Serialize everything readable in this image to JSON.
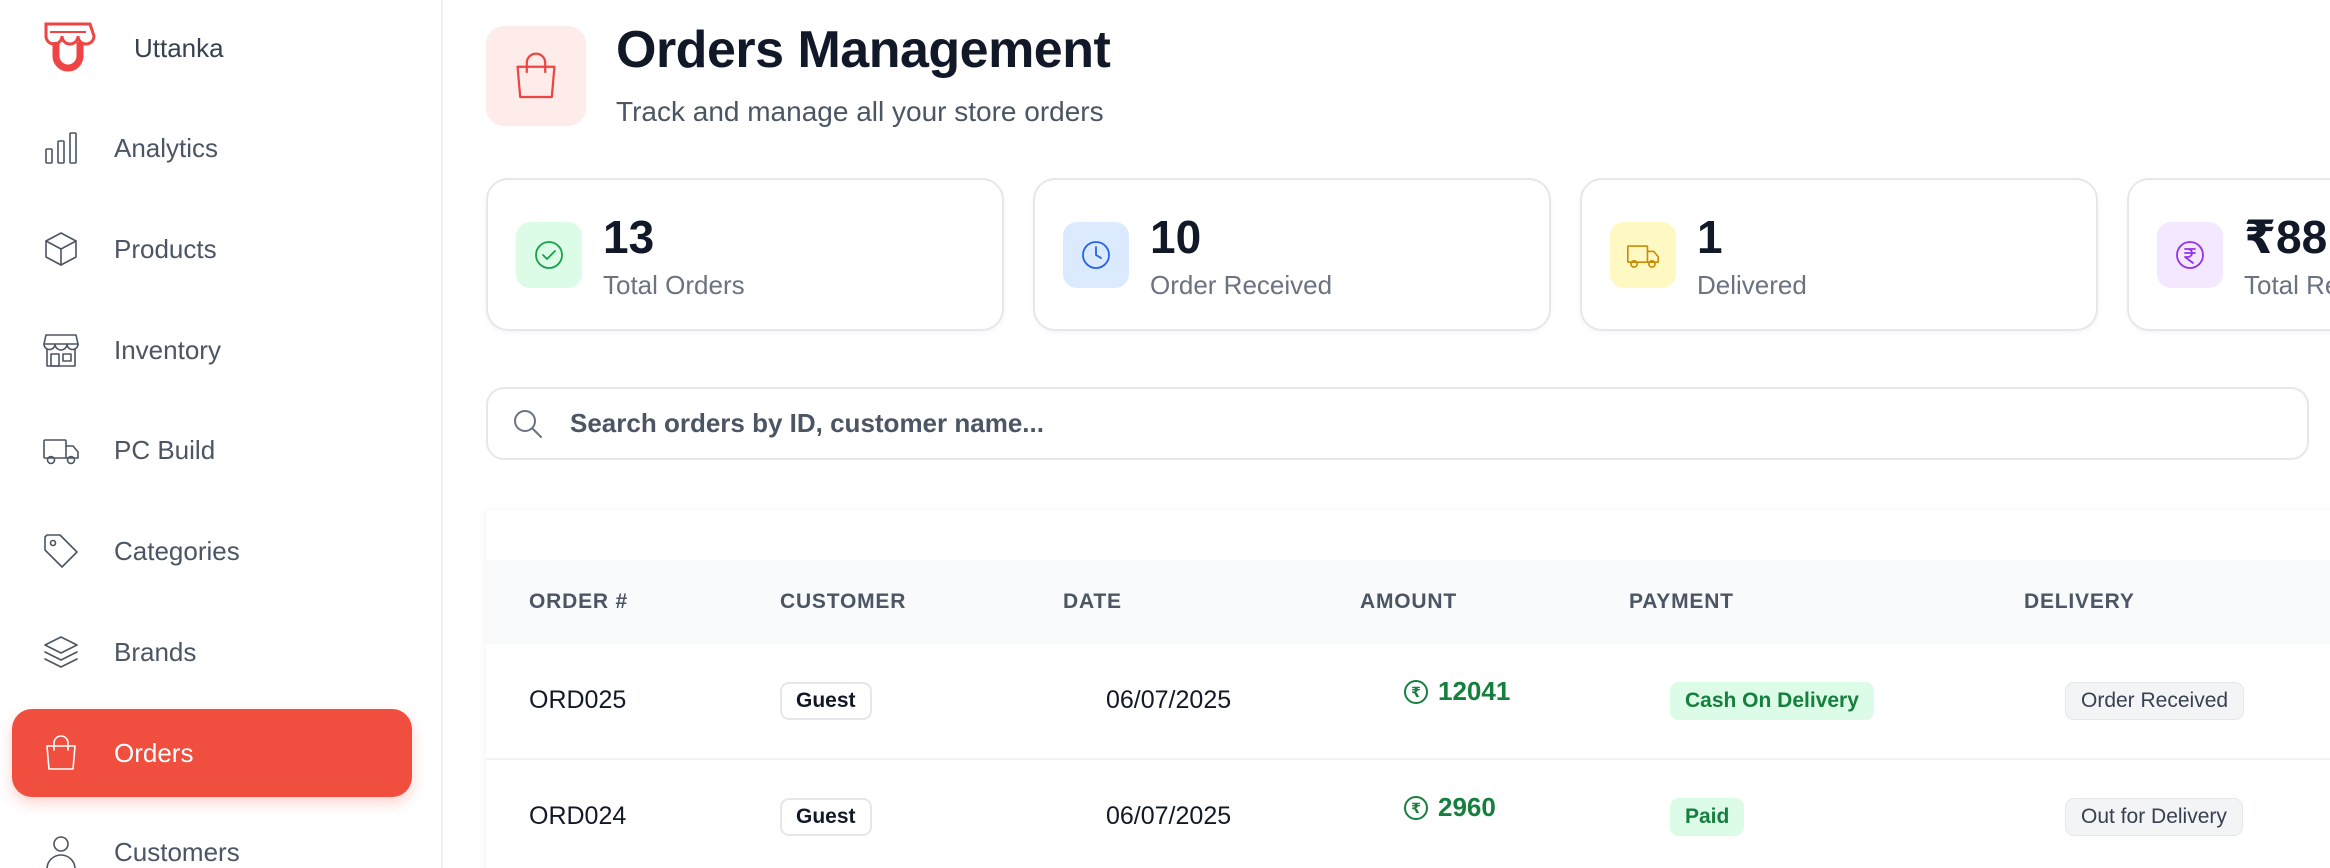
{
  "colors": {
    "accent": "#f04e3e",
    "success": "#15803d",
    "text_primary": "#111827",
    "text_secondary": "#4b5563"
  },
  "sidebar": {
    "brand": {
      "name": "Uttanka",
      "logo_icon": "store-logo-icon"
    },
    "items": [
      {
        "label": "Analytics",
        "icon": "bar-chart-icon",
        "active": false
      },
      {
        "label": "Products",
        "icon": "box-icon",
        "active": false
      },
      {
        "label": "Inventory",
        "icon": "store-icon",
        "active": false
      },
      {
        "label": "PC Build",
        "icon": "truck-icon",
        "active": false
      },
      {
        "label": "Categories",
        "icon": "tag-icon",
        "active": false
      },
      {
        "label": "Brands",
        "icon": "layers-icon",
        "active": false
      },
      {
        "label": "Orders",
        "icon": "shopping-bag-icon",
        "active": true
      },
      {
        "label": "Customers",
        "icon": "user-icon",
        "active": false
      }
    ]
  },
  "header": {
    "icon": "shopping-bag-icon",
    "title": "Orders Management",
    "subtitle": "Track and manage all your store orders"
  },
  "stats": [
    {
      "value": "13",
      "label": "Total Orders",
      "icon": "check-circle-icon",
      "color": "#16a34a",
      "bg": "#dcfce7"
    },
    {
      "value": "10",
      "label": "Order Received",
      "icon": "clock-icon",
      "color": "#2563eb",
      "bg": "#dbeafe"
    },
    {
      "value": "1",
      "label": "Delivered",
      "icon": "truck-icon",
      "color": "#ca8a04",
      "bg": "#fef9c3"
    },
    {
      "value": "₹88,",
      "label": "Total Re",
      "icon": "rupee-circle-icon",
      "color": "#9333ea",
      "bg": "#f3e8ff"
    }
  ],
  "search": {
    "placeholder": "Search orders by ID, customer name..."
  },
  "table": {
    "columns": [
      "ORDER #",
      "CUSTOMER",
      "DATE",
      "AMOUNT",
      "PAYMENT",
      "DELIVERY"
    ],
    "rows": [
      {
        "order": "ORD025",
        "customer": "Guest",
        "date": "06/07/2025",
        "amount": "12041",
        "currency_symbol": "₹",
        "payment": "Cash On Delivery",
        "delivery": "Order Received"
      },
      {
        "order": "ORD024",
        "customer": "Guest",
        "date": "06/07/2025",
        "amount": "2960",
        "currency_symbol": "₹",
        "payment": "Paid",
        "delivery": "Out for Delivery"
      }
    ]
  }
}
